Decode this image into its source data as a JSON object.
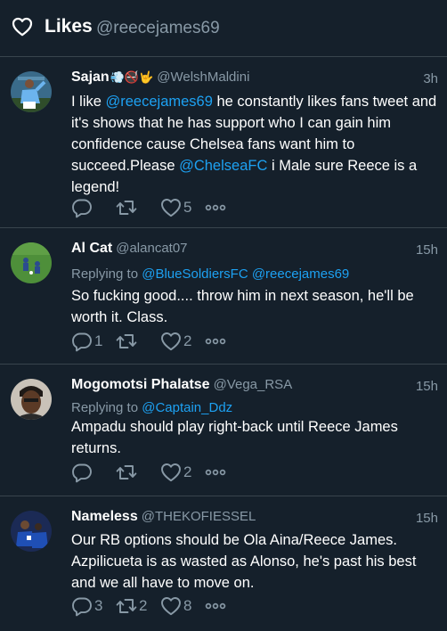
{
  "header": {
    "title": "Likes",
    "handle": "@reecejames69"
  },
  "tweets": [
    {
      "name": "Sajan",
      "emoji": "💨🚭🤟",
      "handle": "@WelshMaldini",
      "time": "3h",
      "text_1": "I like ",
      "mention_1": "@reecejames69",
      "text_2": "  he constantly likes fans tweet and it's shows that he has support who I can gain him confidence cause Chelsea fans want him to succeed.Please ",
      "mention_2": "@ChelseaFC",
      "text_3": " i Male sure Reece is a legend!",
      "replies": "",
      "retweets": "",
      "likes": "5"
    },
    {
      "name": "Al Cat",
      "handle": "@alancat07",
      "time": "15h",
      "replying_label": "Replying to",
      "replying_to_1": "@BlueSoldiersFC",
      "replying_to_2": "@reecejames69",
      "text": "So fucking good.... throw him in next season, he'll be worth it. Class.",
      "replies": "1",
      "retweets": "",
      "likes": "2"
    },
    {
      "name": "Mogomotsi Phalatse",
      "handle": "@Vega_RSA",
      "time": "15h",
      "replying_label": "Replying to",
      "replying_to_1": "@Captain_Ddz",
      "text": "Ampadu should play right-back until Reece James returns.",
      "replies": "",
      "retweets": "",
      "likes": "2"
    },
    {
      "name": "Nameless",
      "handle": "@THEKOFIESSEL",
      "time": "15h",
      "text": "Our RB options should be Ola Aina/Reece James. Azpilicueta is as wasted as Alonso, he's past his best and we all have to move on.",
      "replies": "3",
      "retweets": "2",
      "likes": "8"
    }
  ],
  "icons": {
    "header": "heart-outline-icon",
    "reply": "reply-icon",
    "retweet": "retweet-icon",
    "like": "like-icon",
    "more": "more-icon"
  },
  "colors": {
    "background": "#15202b",
    "divider": "#38444d",
    "muted": "#8899a6",
    "link": "#1da1f2"
  }
}
